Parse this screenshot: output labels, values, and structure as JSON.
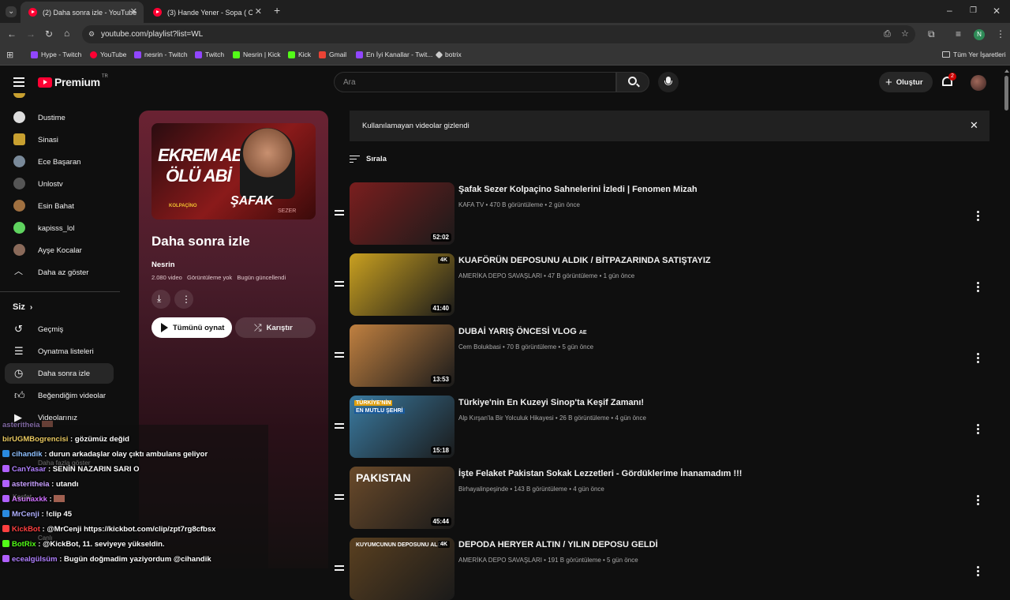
{
  "browser": {
    "tabs": [
      {
        "title": "(2) Daha sonra izle - YouTube",
        "active": true
      },
      {
        "title": "(3) Hande Yener - Sopa ( Club R",
        "active": false
      }
    ],
    "new_tab": "+",
    "url": "youtube.com/playlist?list=WL",
    "profile_initial": "N",
    "bookmarks": [
      {
        "label": "Hype - Twitch",
        "color": "#9146ff"
      },
      {
        "label": "YouTube",
        "color": "#ff0033"
      },
      {
        "label": "nesrin - Twitch",
        "color": "#9146ff"
      },
      {
        "label": "Twitch",
        "color": "#9146ff"
      },
      {
        "label": "Nesrin | Kick",
        "color": "#53fc18"
      },
      {
        "label": "Kick",
        "color": "#53fc18"
      },
      {
        "label": "Gmail",
        "color": "#ea4335"
      },
      {
        "label": "En İyi Kanallar - Twit...",
        "color": "#9146ff"
      },
      {
        "label": "botrix",
        "color": "#cccccc"
      }
    ],
    "all_bookmarks": "Tüm Yer İşaretleri"
  },
  "header": {
    "logo": "Premium",
    "region": "TR",
    "search_placeholder": "Ara",
    "create_label": "Oluştur",
    "notif_count": "2"
  },
  "sidebar": {
    "subscriptions": [
      {
        "label": "Dustime",
        "color": "#ddd"
      },
      {
        "label": "Sinasi",
        "color": "#c8a030"
      },
      {
        "label": "Ece Başaran",
        "color": "#7a8a9a"
      },
      {
        "label": "Unlostv",
        "color": "#555"
      },
      {
        "label": "Esin Bahat",
        "color": "#a07040"
      },
      {
        "label": "kapisss_lol",
        "color": "#5fd35f"
      },
      {
        "label": "Ayşe Kocalar",
        "color": "#8a6a5a"
      }
    ],
    "show_less": "Daha az göster",
    "you_section": "Siz",
    "you_items": [
      {
        "label": "Geçmiş",
        "icon": "history-icon"
      },
      {
        "label": "Oynatma listeleri",
        "icon": "playlists-icon"
      },
      {
        "label": "Daha sonra izle",
        "icon": "watch-later-icon",
        "active": true
      },
      {
        "label": "Beğendiğim videolar",
        "icon": "like-icon"
      },
      {
        "label": "Videolarınız",
        "icon": "your-videos-icon"
      }
    ]
  },
  "playlist": {
    "title": "Daha sonra izle",
    "owner": "Nesrin",
    "stats": "2.080 video   Görüntüleme yok   Bugün güncellendi",
    "play_all": "Tümünü oynat",
    "shuffle": "Karıştır",
    "thumb_text_1": "EKREM ABİ",
    "thumb_text_2": "ÖLÜ ABİ",
    "thumb_text_3": "ŞAFAK",
    "thumb_text_4": "SEZER",
    "thumb_text_5": "KOLPAÇİNO"
  },
  "main": {
    "banner": "Kullanılamayan videolar gizlendi",
    "sort_label": "Sırala",
    "videos": [
      {
        "title": "Şafak Sezer Kolpaçino Sahnelerini İzledi | Fenomen Mizah",
        "meta": "KAFA TV • 470 B görüntüleme • 2 gün önce",
        "duration": "52:02",
        "badge": "",
        "thumb_bg": "#7a1e1e"
      },
      {
        "title": "KUAFÖRÜN DEPOSUNU ALDIK / BİTPAZARINDA SATIŞTAYIZ",
        "meta": "AMERİKA DEPO SAVAŞLARI • 47 B görüntüleme • 1 gün önce",
        "duration": "41:40",
        "badge": "4K",
        "thumb_bg": "#c9a020"
      },
      {
        "title": "DUBAİ YARIŞ ÖNCESİ VLOG",
        "title_suffix": "AE",
        "meta": "Cem Bolukbasi • 70 B görüntüleme • 5 gün önce",
        "duration": "13:53",
        "badge": "",
        "thumb_bg": "#c08040"
      },
      {
        "title": "Türkiye'nin En Kuzeyi Sinop'ta Keşif Zamanı!",
        "meta": "Alp Kırşan'la Bir Yolculuk Hikayesi • 26 B görüntüleme • 4 gün önce",
        "duration": "15:18",
        "badge": "",
        "thumb_bg": "#3a7aa0",
        "thumb_caption_1": "TÜRKİYE'NİN",
        "thumb_caption_2": "EN MUTLU ŞEHRİ"
      },
      {
        "title": "İşte Felaket Pakistan Sokak Lezzetleri - Gördüklerime İnanamadım !!!",
        "meta": "Birhayalinpeşinde • 143 B görüntüleme • 4 gün önce",
        "duration": "45:44",
        "badge": "",
        "thumb_bg": "#6a4a2a",
        "thumb_caption_1": "PAKISTAN"
      },
      {
        "title": "DEPODA HERYER ALTIN / YILIN DEPOSU GELDİ",
        "meta": "AMERİKA DEPO SAVAŞLARI • 191 B görüntüleme • 5 gün önce",
        "duration": "",
        "badge": "4K",
        "thumb_bg": "#5a4020",
        "thumb_caption_1": "KUYUMCUNUN DEPOSUNU ALDIK"
      }
    ]
  },
  "chat": [
    {
      "user": "birUGMBogrencisi",
      "color": "#e8c860",
      "text": ": gözümüz değid"
    },
    {
      "user": "cihandik",
      "color": "#8fc0ff",
      "text": ": durun arkadaşlar olay çıktı ambulans geliyor"
    },
    {
      "user": "CanYasar",
      "color": "#b080ff",
      "text": ": SENİN NAZARIN SARI O"
    },
    {
      "user": "asteritheia",
      "color": "#c8a0ff",
      "text": ": utandı"
    },
    {
      "user": "Asunaxkk",
      "color": "#d070ff",
      "text": ":"
    },
    {
      "user": "MrCenji",
      "color": "#b0b0ff",
      "text": ": !clip 45"
    },
    {
      "user": "KickBot",
      "color": "#ff4040",
      "text": ": @MrCenji https://kickbot.com/clip/zpt7rg8cfbsx"
    },
    {
      "user": "BotRix",
      "color": "#53fc18",
      "text": ": @KickBot, 11. seviyeye yükseldin."
    },
    {
      "user": "ecealgülsüm",
      "color": "#b080ff",
      "text": ": Bugün doğmadim yaziyordum @cihandik"
    }
  ],
  "chat_overflow": {
    "top_user": "asteritheia",
    "more": "Daha fazla göster",
    "keşfet": "Keşfet",
    "canli": "Canlı"
  }
}
